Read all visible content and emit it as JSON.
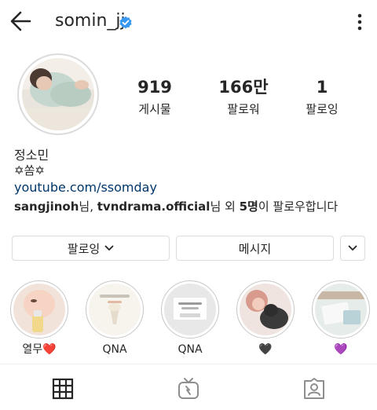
{
  "header": {
    "username": "somin_jj",
    "verified": true,
    "icons": {
      "back": "arrow-left-icon",
      "more": "vertical-dots-icon",
      "verified": "verified-badge-icon"
    },
    "verified_color": "#3897f0"
  },
  "stats": [
    {
      "value": "919",
      "label": "게시물"
    },
    {
      "value": "166만",
      "label": "팔로워"
    },
    {
      "value": "1",
      "label": "팔로잉"
    }
  ],
  "bio": {
    "full_name": "정소민",
    "text": "✡쏨✡",
    "link": "youtube.com/ssomday",
    "followed_by": {
      "user1": "sangjinoh",
      "sep1": "님, ",
      "user2": "tvndrama.official",
      "sep2": "님 외 ",
      "count": "5명",
      "suffix": "이 팔로우합니다"
    }
  },
  "actions": {
    "following_label": "팔로잉",
    "message_label": "메시지",
    "dropdown_icon": "chevron-down-icon"
  },
  "highlights": [
    {
      "label": "열무❤️"
    },
    {
      "label": "QNA"
    },
    {
      "label": "QNA"
    },
    {
      "label": "🖤"
    },
    {
      "label": "💜"
    }
  ],
  "tabs": [
    {
      "icon": "grid-icon",
      "active": true
    },
    {
      "icon": "igtv-icon",
      "active": false
    },
    {
      "icon": "tagged-icon",
      "active": false
    }
  ],
  "colors": {
    "link": "#00376b",
    "border": "#dbdbdb",
    "text": "#262626"
  }
}
